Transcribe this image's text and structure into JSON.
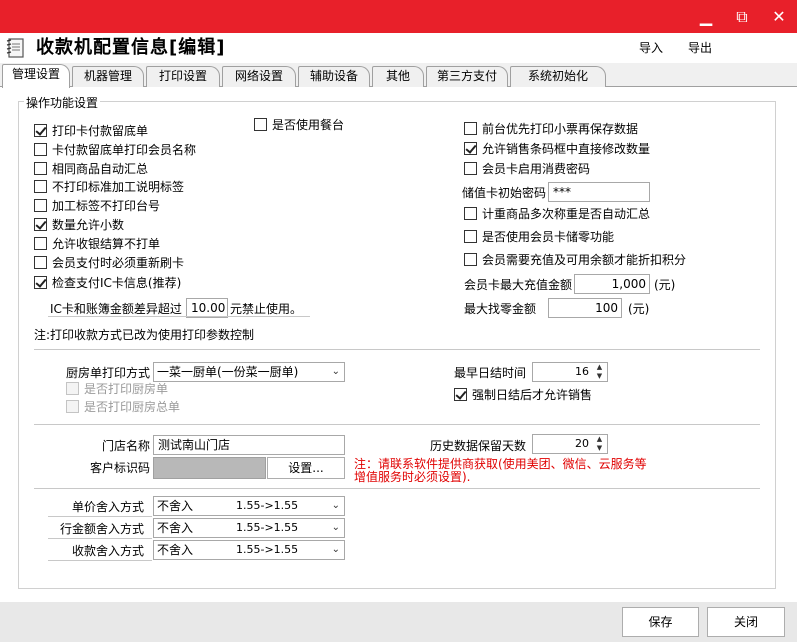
{
  "window": {
    "title": "收款机配置信息[编辑]",
    "controls": {
      "minimize": "▁",
      "maximize": "⧉",
      "close": "✕"
    }
  },
  "header": {
    "import_label": "导入",
    "export_label": "导出"
  },
  "tabs": [
    {
      "label": "管理设置",
      "active": true
    },
    {
      "label": "机器管理"
    },
    {
      "label": "打印设置"
    },
    {
      "label": "网络设置"
    },
    {
      "label": "辅助设备"
    },
    {
      "label": "其他"
    },
    {
      "label": "第三方支付"
    },
    {
      "label": "系统初始化"
    }
  ],
  "group": {
    "title": "操作功能设置"
  },
  "left_options": [
    {
      "label": "打印卡付款留底单",
      "checked": true
    },
    {
      "label": "卡付款留底单打印会员名称",
      "checked": false
    },
    {
      "label": "相同商品自动汇总",
      "checked": false
    },
    {
      "label": "不打印标准加工说明标签",
      "checked": false
    },
    {
      "label": "加工标签不打印台号",
      "checked": false
    },
    {
      "label": "数量允许小数",
      "checked": true
    },
    {
      "label": "允许收银结算不打单",
      "checked": false
    },
    {
      "label": "会员支付时必须重新刷卡",
      "checked": false
    },
    {
      "label": "检查支付IC卡信息(推荐)",
      "checked": true
    }
  ],
  "mid_option": {
    "label": "是否使用餐台",
    "checked": false
  },
  "right_options": [
    {
      "label": "前台优先打印小票再保存数据",
      "checked": false
    },
    {
      "label": "允许销售条码框中直接修改数量",
      "checked": true
    },
    {
      "label": "会员卡启用消费密码",
      "checked": false
    }
  ],
  "right_options2": [
    {
      "label": "计重商品多次称重是否自动汇总",
      "checked": false
    },
    {
      "label": "是否使用会员卡储零功能",
      "checked": false
    },
    {
      "label": "会员需要充值及可用余额才能折扣积分",
      "checked": false
    }
  ],
  "ic_diff": {
    "prefix": "IC卡和账簿金额差异超过",
    "value": "10.00",
    "suffix": "元禁止使用。"
  },
  "card_password": {
    "label": "储值卡初始密码",
    "value": "***"
  },
  "max_recharge": {
    "label": "会员卡最大充值金额",
    "value": "1,000",
    "unit": "(元)"
  },
  "max_change": {
    "label": "最大找零金额",
    "value": "100",
    "unit": "(元)"
  },
  "note_print": "注:打印收款方式已改为使用打印参数控制",
  "kitchen": {
    "label": "厨房单打印方式",
    "value": "一菜一厨单(一份菜一厨单)",
    "opt1": {
      "label": "是否打印厨房单",
      "checked": false
    },
    "opt2": {
      "label": "是否打印厨房总单",
      "checked": false
    }
  },
  "earliest_close": {
    "label": "最早日结时间",
    "value": "16"
  },
  "force_close": {
    "label": "强制日结后才允许销售",
    "checked": true
  },
  "store": {
    "label": "门店名称",
    "value": "测试南山门店"
  },
  "history": {
    "label": "历史数据保留天数",
    "value": "20"
  },
  "customer_id": {
    "label": "客户标识码",
    "button": "设置..."
  },
  "red_note": {
    "line1": "注：请联系软件提供商获取(使用美团、微信、云服务等",
    "line2": "增值服务时必须设置)."
  },
  "rounding": [
    {
      "label": "单价舍入方式",
      "mode": "不舍入",
      "example": "1.55->1.55"
    },
    {
      "label": "行金额舍入方式",
      "mode": "不舍入",
      "example": "1.55->1.55"
    },
    {
      "label": "收款舍入方式",
      "mode": "不舍入",
      "example": "1.55->1.55"
    }
  ],
  "footer": {
    "save_label": "保存",
    "close_label": "关闭"
  },
  "colors": {
    "titlebar": "#e8202a",
    "note_red": "#e00000"
  }
}
